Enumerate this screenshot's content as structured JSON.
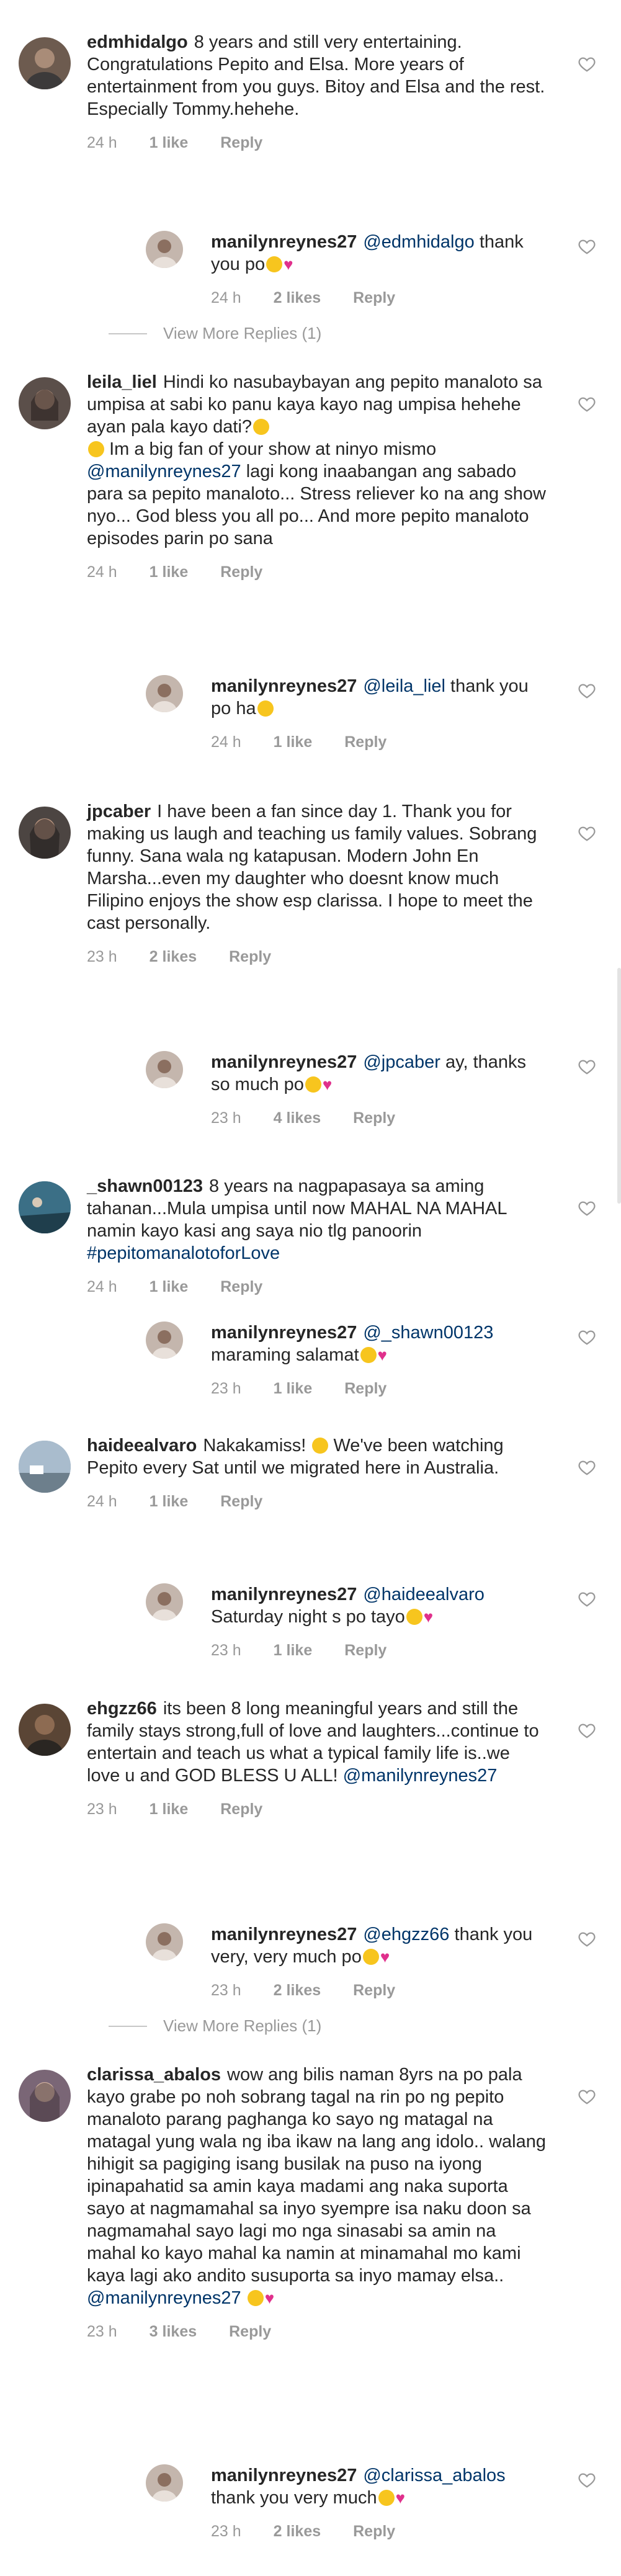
{
  "icons": {
    "like": "heart-outline-icon",
    "emoji_smile": "smile-emoji-icon",
    "emoji_heart": "pink-heart-emoji-icon"
  },
  "colors": {
    "meta": "#999999",
    "mention": "#003569",
    "text": "#262626"
  },
  "comments": [
    {
      "user": "edmhidalgo",
      "text": "8 years and still very entertaining. Congratulations  Pepito and Elsa.  More years of  entertainment from you guys. Bitoy and Elsa and the rest. Especially Tommy.hehehe.",
      "time": "24 h",
      "likes": "1 like",
      "reply": "Reply"
    },
    {
      "user": "manilynreynes27",
      "mention": "@edmhidalgo",
      "text": "thank you po",
      "time": "24 h",
      "likes": "2 likes",
      "reply": "Reply"
    },
    {
      "view_more": "View More Replies (1)"
    },
    {
      "user": "leila_liel",
      "text": "Hindi ko nasubaybayan ang pepito manaloto sa umpisa at sabi ko panu kaya kayo nag umpisa hehehe ayan pala kayo dati?",
      "text2": "Im a big fan of your show at ninyo mismo",
      "mention": "@manilynreynes27",
      "text3": "lagi kong inaabangan ang sabado para sa pepito manaloto... Stress reliever ko na ang show nyo... God bless you all po... And more pepito manaloto episodes parin po sana",
      "time": "24 h",
      "likes": "1 like",
      "reply": "Reply"
    },
    {
      "user": "manilynreynes27",
      "mention": "@leila_liel",
      "text": "thank you po ha",
      "time": "24 h",
      "likes": "1 like",
      "reply": "Reply"
    },
    {
      "user": "jpcaber",
      "text": "I have been a fan since day 1. Thank you for making us laugh and teaching us family values. Sobrang funny. Sana wala ng katapusan. Modern John En Marsha...even my daughter who doesnt know much Filipino enjoys the show esp clarissa. I hope to meet the cast personally.",
      "time": "23 h",
      "likes": "2 likes",
      "reply": "Reply"
    },
    {
      "user": "manilynreynes27",
      "mention": "@jpcaber",
      "text": "ay, thanks so much po",
      "time": "23 h",
      "likes": "4 likes",
      "reply": "Reply"
    },
    {
      "user": "_shawn00123",
      "text": "8 years na nagpapasaya sa aming tahanan...Mula umpisa until now MAHAL NA MAHAL namin kayo kasi ang saya nio tlg panoorin",
      "hashtag": "#pepitomanalotoforLove",
      "time": "24 h",
      "likes": "1 like",
      "reply": "Reply"
    },
    {
      "user": "manilynreynes27",
      "mention": "@_shawn00123",
      "text": "maraming salamat",
      "time": "23 h",
      "likes": "1 like",
      "reply": "Reply"
    },
    {
      "user": "haideealvaro",
      "text": "Nakakamiss!",
      "text2": "We've been watching Pepito every Sat until we migrated here in Australia.",
      "time": "24 h",
      "likes": "1 like",
      "reply": "Reply"
    },
    {
      "user": "manilynreynes27",
      "mention": "@haideealvaro",
      "text": "Saturday night s po tayo",
      "time": "23 h",
      "likes": "1 like",
      "reply": "Reply"
    },
    {
      "user": "ehgzz66",
      "text": "its been 8 long meaningful years and still the family stays strong,full of love and laughters...continue to entertain and teach us what a typical family life is..we love u and GOD BLESS U ALL!",
      "mention": "@manilynreynes27",
      "time": "23 h",
      "likes": "1 like",
      "reply": "Reply"
    },
    {
      "user": "manilynreynes27",
      "mention": "@ehgzz66",
      "text": "thank you very, very much po",
      "time": "23 h",
      "likes": "2 likes",
      "reply": "Reply"
    },
    {
      "view_more": "View More Replies (1)"
    },
    {
      "user": "clarissa_abalos",
      "text": "wow ang bilis naman 8yrs na po pala kayo grabe po noh sobrang tagal na rin po ng pepito manaloto parang paghanga ko sayo ng matagal na matagal yung wala ng iba ikaw na lang ang idolo.. walang hihigit sa pagiging isang busilak na puso na iyong ipinapahatid sa amin kaya madami ang naka suporta sayo at nagmamahal sa inyo syempre isa naku doon sa nagmamahal sayo lagi mo nga sinasabi sa amin na mahal ko kayo mahal ka namin at minamahal mo kami kaya lagi ako andito susuporta sa inyo mamay elsa..",
      "mention": "@manilynreynes27",
      "time": "23 h",
      "likes": "3 likes",
      "reply": "Reply"
    },
    {
      "user": "manilynreynes27",
      "mention": "@clarissa_abalos",
      "text": "thank you very much",
      "time": "23 h",
      "likes": "2 likes",
      "reply": "Reply"
    }
  ]
}
